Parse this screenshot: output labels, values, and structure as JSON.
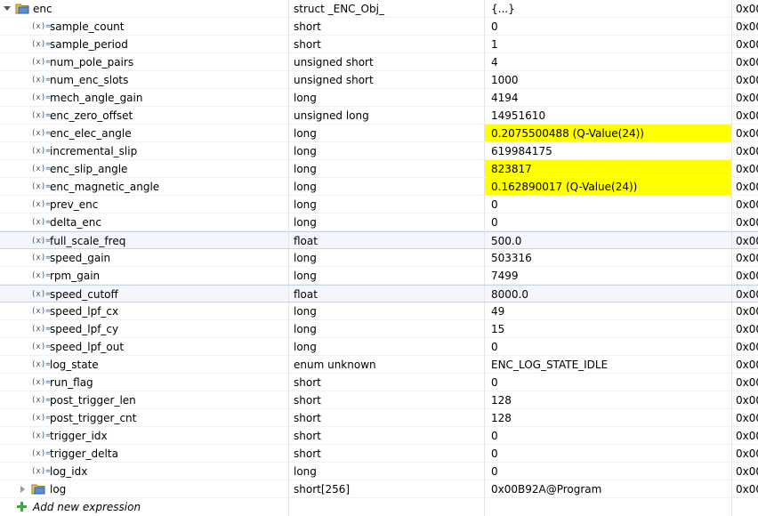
{
  "root": {
    "name": "enc",
    "type": "struct _ENC_Obj_",
    "value": "{...}",
    "address": "0x00"
  },
  "rows": [
    {
      "name": "sample_count",
      "type": "short",
      "value": "0",
      "address": "0x00"
    },
    {
      "name": "sample_period",
      "type": "short",
      "value": "1",
      "address": "0x00"
    },
    {
      "name": "num_pole_pairs",
      "type": "unsigned short",
      "value": "4",
      "address": "0x00"
    },
    {
      "name": "num_enc_slots",
      "type": "unsigned short",
      "value": "1000",
      "address": "0x00"
    },
    {
      "name": "mech_angle_gain",
      "type": "long",
      "value": "4194",
      "address": "0x00"
    },
    {
      "name": "enc_zero_offset",
      "type": "unsigned long",
      "value": "14951610",
      "address": "0x00"
    },
    {
      "name": "enc_elec_angle",
      "type": "long",
      "value": "0.2075500488 (Q-Value(24))",
      "address": "0x00",
      "changed": true
    },
    {
      "name": "incremental_slip",
      "type": "long",
      "value": "619984175",
      "address": "0x00"
    },
    {
      "name": "enc_slip_angle",
      "type": "long",
      "value": "823817",
      "address": "0x00",
      "changed": true
    },
    {
      "name": "enc_magnetic_angle",
      "type": "long",
      "value": "0.162890017 (Q-Value(24))",
      "address": "0x00",
      "changed": true
    },
    {
      "name": "prev_enc",
      "type": "long",
      "value": "0",
      "address": "0x00"
    },
    {
      "name": "delta_enc",
      "type": "long",
      "value": "0",
      "address": "0x00"
    },
    {
      "name": "full_scale_freq",
      "type": "float",
      "value": "500.0",
      "address": "0x00",
      "selected": true
    },
    {
      "name": "speed_gain",
      "type": "long",
      "value": "503316",
      "address": "0x00"
    },
    {
      "name": "rpm_gain",
      "type": "long",
      "value": "7499",
      "address": "0x00"
    },
    {
      "name": "speed_cutoff",
      "type": "float",
      "value": "8000.0",
      "address": "0x00",
      "selected": true
    },
    {
      "name": "speed_lpf_cx",
      "type": "long",
      "value": "49",
      "address": "0x00"
    },
    {
      "name": "speed_lpf_cy",
      "type": "long",
      "value": "15",
      "address": "0x00"
    },
    {
      "name": "speed_lpf_out",
      "type": "long",
      "value": "0",
      "address": "0x00"
    },
    {
      "name": "log_state",
      "type": "enum unknown",
      "value": "ENC_LOG_STATE_IDLE",
      "address": "0x00"
    },
    {
      "name": "run_flag",
      "type": "short",
      "value": "0",
      "address": "0x00"
    },
    {
      "name": "post_trigger_len",
      "type": "short",
      "value": "128",
      "address": "0x00"
    },
    {
      "name": "post_trigger_cnt",
      "type": "short",
      "value": "128",
      "address": "0x00"
    },
    {
      "name": "trigger_idx",
      "type": "short",
      "value": "0",
      "address": "0x00"
    },
    {
      "name": "trigger_delta",
      "type": "short",
      "value": "0",
      "address": "0x00"
    },
    {
      "name": "log_idx",
      "type": "long",
      "value": "0",
      "address": "0x00"
    }
  ],
  "log": {
    "name": "log",
    "type": "short[256]",
    "value": "0x00B92A@Program",
    "address": "0x00"
  },
  "add_expression_label": "Add new expression",
  "variable_icon_glyph": "(x)=",
  "icons": {
    "struct": "struct-icon",
    "variable": "variable-icon",
    "add": "add-icon"
  },
  "colors": {
    "changed_value": "#ffff00",
    "selected_row": "#f3f6fc"
  }
}
